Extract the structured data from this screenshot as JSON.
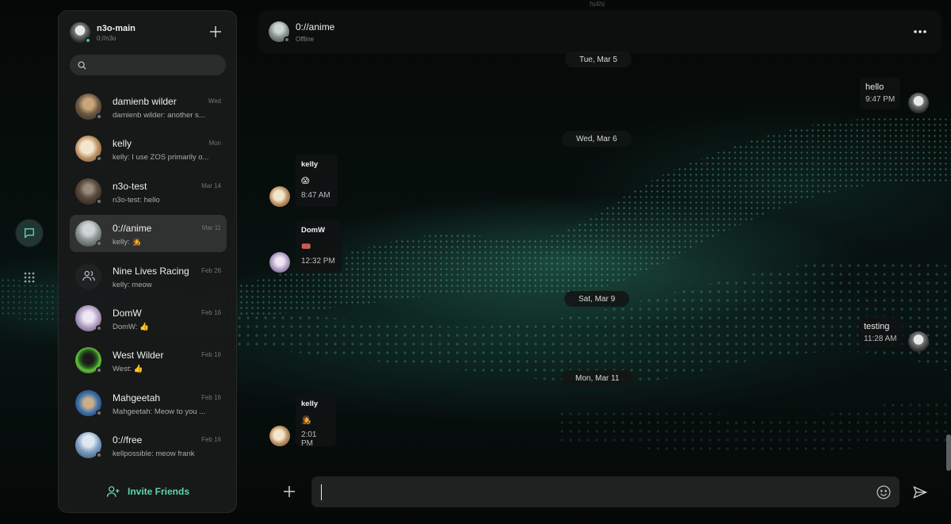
{
  "account": {
    "name": "n3o-main",
    "handle": "0://n3o"
  },
  "search": {
    "placeholder": ""
  },
  "top_peek": "hi4hi",
  "conversations": [
    {
      "name": "damienb wilder",
      "date": "Wed",
      "preview": "damienb wilder: another s...",
      "avatar_color": "#6b5a45"
    },
    {
      "name": "kelly",
      "date": "Mon",
      "preview": "kelly: I use ZOS primarily o...",
      "avatar_color": "#d9c9a6"
    },
    {
      "name": "n3o-test",
      "date": "Mar 14",
      "preview": "n3o-test: hello",
      "avatar_color": "#5a4a3e"
    },
    {
      "name": "0://anime",
      "date": "Mar 11",
      "preview": "kelly: 🧑‍🎤",
      "avatar_color": "#8b9393"
    },
    {
      "name": "Nine Lives Racing",
      "date": "Feb 26",
      "preview": "kelly: meow",
      "avatar_color": "#1f2222"
    },
    {
      "name": "DomW",
      "date": "Feb 16",
      "preview": "DomW: 👍",
      "avatar_color": "#b8a7c9"
    },
    {
      "name": "West Wilder",
      "date": "Feb 16",
      "preview": "West: 👍",
      "avatar_color": "#2c5a1f"
    },
    {
      "name": "Mahgeetah",
      "date": "Feb 16",
      "preview": "Mahgeetah: Meow to you ...",
      "avatar_color": "#3a6ea8"
    },
    {
      "name": "0://free",
      "date": "Feb 16",
      "preview": "kellpossible: meow frank",
      "avatar_color": "#7fa1c4"
    }
  ],
  "invite_label": "Invite Friends",
  "chat_header": {
    "title": "0://anime",
    "status": "Offline"
  },
  "dates": [
    "Tue, Mar 5",
    "Wed, Mar 6",
    "Sat, Mar 9",
    "Mon, Mar 11"
  ],
  "messages": [
    {
      "sender": "",
      "text": "hello",
      "time": "9:47 PM",
      "own": true
    },
    {
      "sender": "kelly",
      "text": "😱",
      "time": "8:47 AM",
      "own": false
    },
    {
      "sender": "DomW",
      "text": "🎟️",
      "time": "12:32 PM",
      "own": false
    },
    {
      "sender": "",
      "text": "testing",
      "time": "11:28 AM",
      "own": true
    },
    {
      "sender": "kelly",
      "text": "🧑‍🎤",
      "time": "2:01 PM",
      "own": false
    }
  ],
  "composer": {
    "value": ""
  },
  "colors": {
    "accent": "#5fd6b3",
    "online": "#43c56e",
    "offline": "#6f7572"
  }
}
